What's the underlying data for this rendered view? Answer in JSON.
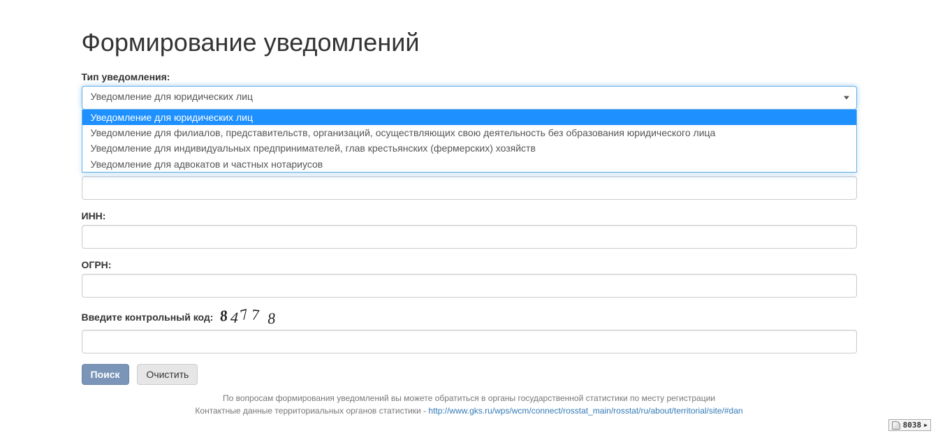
{
  "page": {
    "title": "Формирование уведомлений"
  },
  "form": {
    "type_label": "Тип уведомления:",
    "type_selected": "Уведомление для юридических лиц",
    "type_options": [
      "Уведомление для юридических лиц",
      "Уведомление для филиалов, представительств, организаций, осуществляющих свою деятельность без образования юридического лица",
      "Уведомление для индивидуальных предпринимателей, глав крестьянских (фермерских) хозяйств",
      "Уведомление для адвокатов и частных нотариусов"
    ],
    "inn_label": "ИНН:",
    "inn_value": "",
    "ogrn_label": "ОГРН:",
    "ogrn_value": "",
    "captcha_label": "Введите контрольный код:",
    "captcha_code": "84778",
    "captcha_value": "",
    "search_button": "Поиск",
    "clear_button": "Очистить"
  },
  "footer": {
    "line1": "По вопросам формирования уведомлений вы можете обратиться в органы государственной статистики по месту регистрации",
    "line2_prefix": "Контактные данные территориальных органов статистики - ",
    "line2_link": "http://www.gks.ru/wps/wcm/connect/rosstat_main/rosstat/ru/about/territorial/site/#dan"
  },
  "counter": {
    "value": "8038"
  }
}
